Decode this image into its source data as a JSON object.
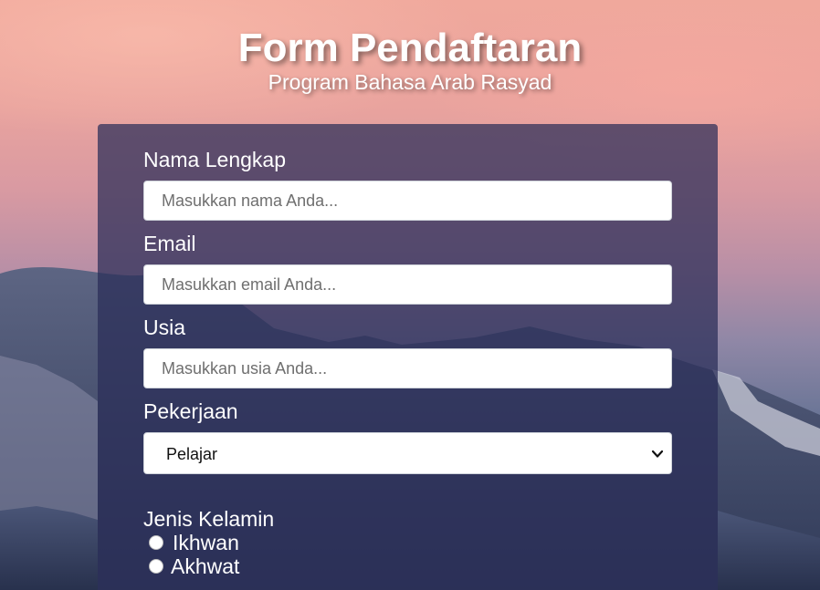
{
  "header": {
    "title": "Form Pendaftaran",
    "subtitle": "Program Bahasa Arab Rasyad"
  },
  "form": {
    "name": {
      "label": "Nama Lengkap",
      "placeholder": "Masukkan nama Anda...",
      "value": ""
    },
    "email": {
      "label": "Email",
      "placeholder": "Masukkan email Anda...",
      "value": ""
    },
    "age": {
      "label": "Usia",
      "placeholder": "Masukkan usia Anda...",
      "value": ""
    },
    "job": {
      "label": "Pekerjaan",
      "selected": "Pelajar"
    },
    "gender": {
      "label": "Jenis Kelamin",
      "options": [
        {
          "label": "Ikhwan",
          "checked": false
        },
        {
          "label": "Akhwat",
          "checked": false
        }
      ]
    }
  },
  "colors": {
    "card": "#2a2c58",
    "text": "#ffffff",
    "sky_top": "#f0a89c",
    "mountain": "#3d4a68"
  },
  "icons": {
    "select_arrow": "chevron-down-icon"
  }
}
